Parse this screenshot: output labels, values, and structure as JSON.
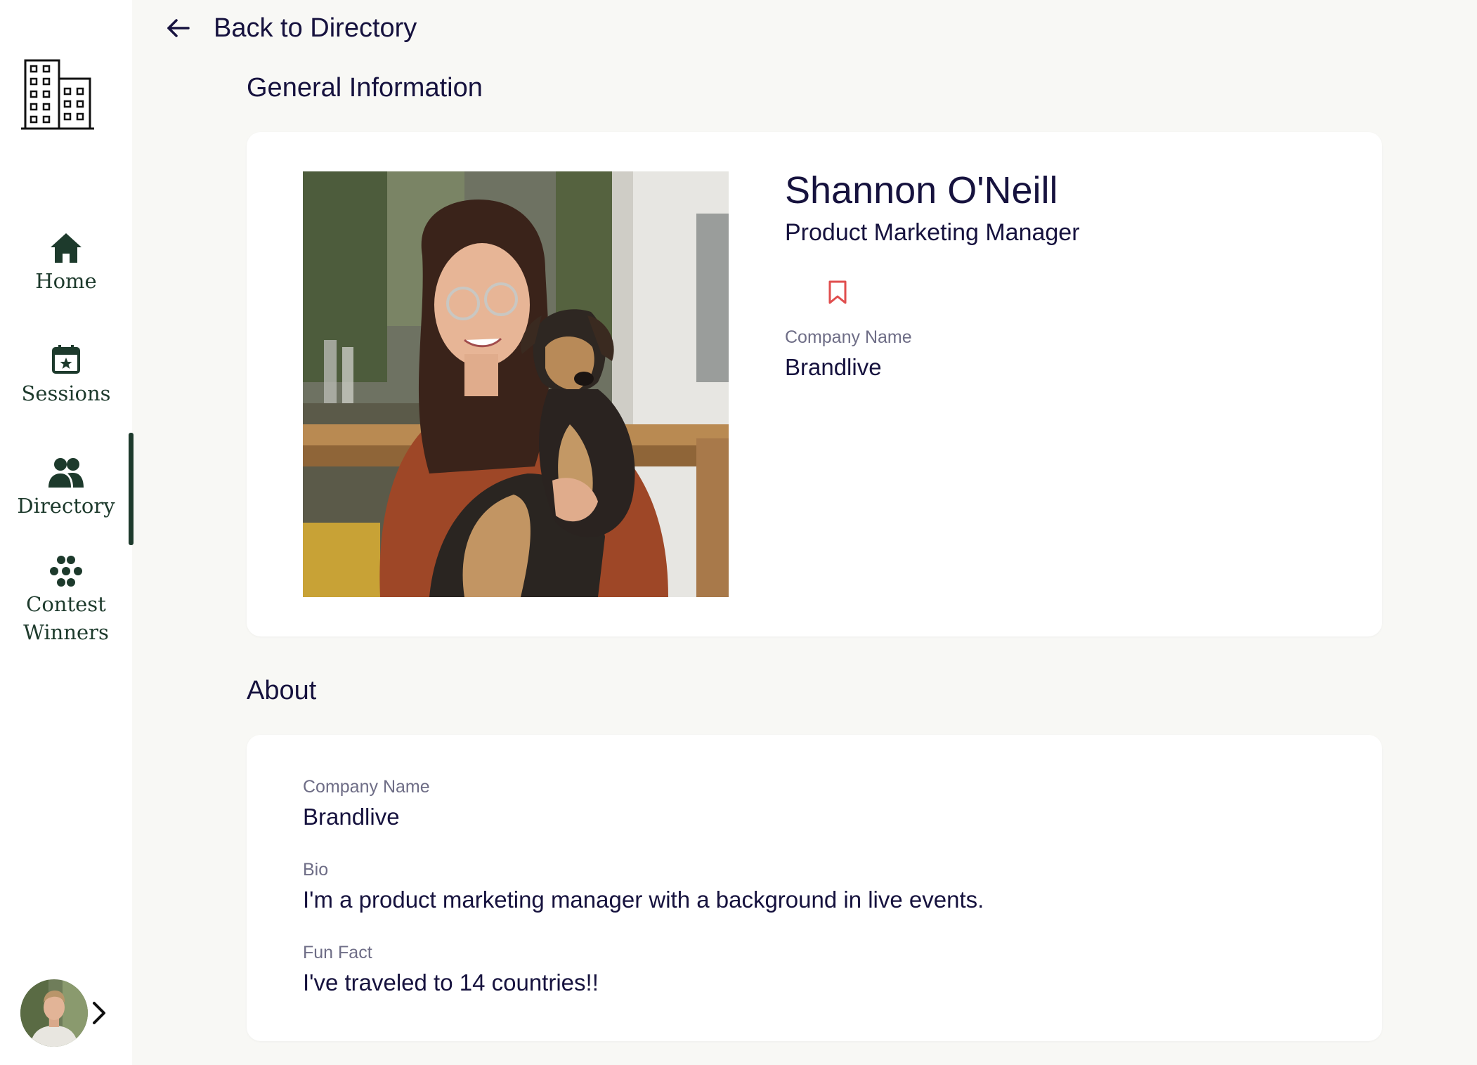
{
  "sidebar": {
    "logo": "building-logo",
    "items": [
      {
        "label": "Home",
        "icon": "home-icon"
      },
      {
        "label": "Sessions",
        "icon": "calendar-star-icon"
      },
      {
        "label": "Directory",
        "icon": "people-icon"
      },
      {
        "label": "Contest\nWinners",
        "icon": "flower-dots-icon"
      }
    ],
    "active_item": "Directory",
    "accent_color": "#1d3a2c"
  },
  "header": {
    "back_label": "Back to Directory"
  },
  "general": {
    "section_title": "General Information",
    "name": "Shannon O'Neill",
    "job_title": "Product Marketing Manager",
    "bookmark_icon": "bookmark-icon",
    "bookmark_color": "#e04e4e",
    "company_label": "Company Name",
    "company_value": "Brandlive"
  },
  "about": {
    "section_title": "About",
    "company_label": "Company Name",
    "company_value": "Brandlive",
    "bio_label": "Bio",
    "bio_value": "I'm a product marketing manager with a background in live events.",
    "fun_fact_label": "Fun Fact",
    "fun_fact_value": "I've traveled to 14 countries!!"
  }
}
